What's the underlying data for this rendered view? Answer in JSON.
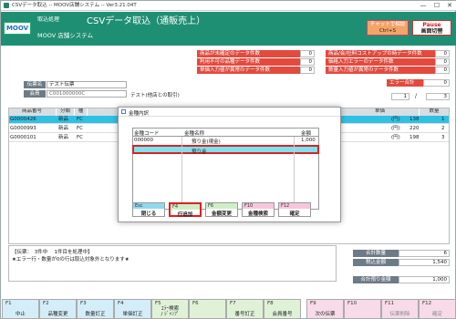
{
  "window": {
    "title": "CSVデータ取込 -- MOOV店舗システム -- Ver3.21.04T",
    "minimize": "—",
    "maximize": "☐",
    "close": "✕"
  },
  "header": {
    "logo": "MOOV",
    "mode": "取込処理",
    "title": "CSVデータ取込（通販売上）",
    "system": "MOOV 店舗システム",
    "chat_button": "チャットで相談",
    "chat_sub": "Ctrl+S",
    "pause_button": "Pause",
    "pause_sub": "画面切替"
  },
  "warnings_left": [
    {
      "label": "商品が未確定のデータ件数",
      "value": "0"
    },
    {
      "label": "判用不可の品種データ件数",
      "value": "0"
    },
    {
      "label": "単価入力値が異常のデータ件数",
      "value": "0"
    }
  ],
  "warnings_right": [
    {
      "label": "商品/会/社料コストアップの時データ件数",
      "value": "0"
    },
    {
      "label": "価格入力エラーのデータ件数",
      "value": "0"
    },
    {
      "label": "数量入力値が異常のデータ件数",
      "value": "0"
    }
  ],
  "error_count": {
    "label": "エラー合計",
    "value": "0"
  },
  "paging": {
    "current": "1",
    "separator": "/",
    "total": "3"
  },
  "slip": {
    "slip_label": "伝票名",
    "slip_value": "テスト伝票",
    "member_label": "会員",
    "member_value": "C001000000C",
    "member_name": "テスト(他店との取引)"
  },
  "table": {
    "headers": [
      "商品番号",
      "分類",
      "種",
      "単価",
      "数量"
    ],
    "rows": [
      {
        "code": "G0000426",
        "kind": "新品",
        "grp": "FC",
        "unit": "(円)",
        "price": "138",
        "qty": "1"
      },
      {
        "code": "G0000993",
        "kind": "新品",
        "grp": "FC",
        "unit": "(円)",
        "price": "220",
        "qty": "2"
      },
      {
        "code": "G0000101",
        "kind": "新品",
        "grp": "FC",
        "unit": "(円)",
        "price": "198",
        "qty": "3"
      }
    ]
  },
  "dialog": {
    "title": "金種内訳",
    "col_code": "金種コード",
    "col_name": "金種名称",
    "col_amount": "金額",
    "rows": [
      {
        "code": "000000",
        "name": "預り金(現金)",
        "amount": "1,000"
      },
      {
        "code": "",
        "name": "預り金",
        "amount": ""
      }
    ],
    "buttons": [
      {
        "key": "Esc",
        "label": "閉じる",
        "color": "#8fd9ee"
      },
      {
        "key": "F4",
        "label": "行追加",
        "color": "#cfeec6"
      },
      {
        "key": "F6",
        "label": "金額変更",
        "color": "#cfeec6"
      },
      {
        "key": "F10",
        "label": "金種検索",
        "color": "#f8c6dc"
      },
      {
        "key": "F12",
        "label": "確定",
        "color": "#f8c6dc"
      }
    ]
  },
  "message": {
    "line1": "【伝票：　3件中　 1件目を処理中】",
    "line2": "★エラー行・数量が0の行は取込対象外となります★"
  },
  "totals": [
    {
      "label": "合計数量",
      "value": "6"
    },
    {
      "label": "税込金額",
      "value": "1,540"
    },
    {
      "label": "合計預り金額",
      "value": "1,000"
    }
  ],
  "fkeys": [
    {
      "key": "F1",
      "label": "中止",
      "color": "#d3eef8"
    },
    {
      "key": "F2",
      "label": "品種変更",
      "color": "#d3eef8"
    },
    {
      "key": "F3",
      "label": "数量訂正",
      "color": "#d3eef8"
    },
    {
      "key": "F4",
      "label": "単価訂正",
      "color": "#d3eef8"
    },
    {
      "key": "F5",
      "label": "ｴﾗｰ検索\n/ ｼﾞｬﾝﾌﾟ",
      "color": "#dff2d8"
    },
    {
      "key": "F6",
      "label": "",
      "color": "#dff2d8"
    },
    {
      "key": "F7",
      "label": "番号訂正",
      "color": "#dff2d8"
    },
    {
      "key": "F8",
      "label": "会員番号",
      "color": "#dff2d8"
    },
    {
      "key": "F9",
      "label": "次の伝票",
      "color": "#f8dbe8"
    },
    {
      "key": "F10",
      "label": "",
      "color": "#f8dbe8"
    },
    {
      "key": "F11",
      "label": "伝票削除",
      "color": "#f8dbe8"
    },
    {
      "key": "F12",
      "label": "確定",
      "color": "#f8dbe8"
    }
  ]
}
